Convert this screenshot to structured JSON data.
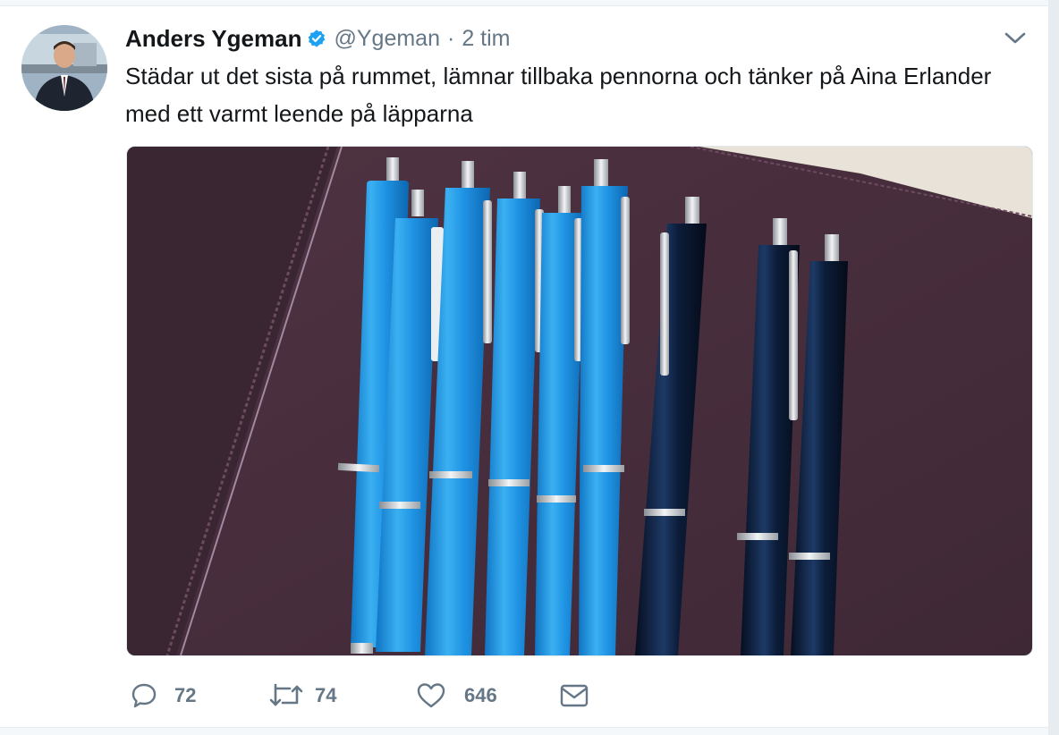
{
  "tweet": {
    "display_name": "Anders Ygeman",
    "verified": true,
    "handle": "@Ygeman",
    "separator": "·",
    "time": "2 tim",
    "text": "Städar ut det sista på rummet, lämnar tillbaka pennorna och tänker på Aina Erlander med ett varmt leende på läpparna",
    "media": {
      "description_icon": "photo"
    },
    "actions": {
      "reply_count": "72",
      "retweet_count": "74",
      "like_count": "646"
    }
  },
  "icons": {
    "avatar": "avatar",
    "verified": "verified-badge-icon",
    "menu": "chevron-down-icon",
    "reply": "reply-icon",
    "retweet": "retweet-icon",
    "like": "heart-icon",
    "dm": "envelope-icon"
  },
  "colors": {
    "text": "#14171a",
    "secondary": "#657786",
    "verified": "#1da1f2",
    "pen_blue": "#1e8fe0",
    "pen_navy": "#0c1d3a",
    "leather": "#4a2f3e"
  }
}
